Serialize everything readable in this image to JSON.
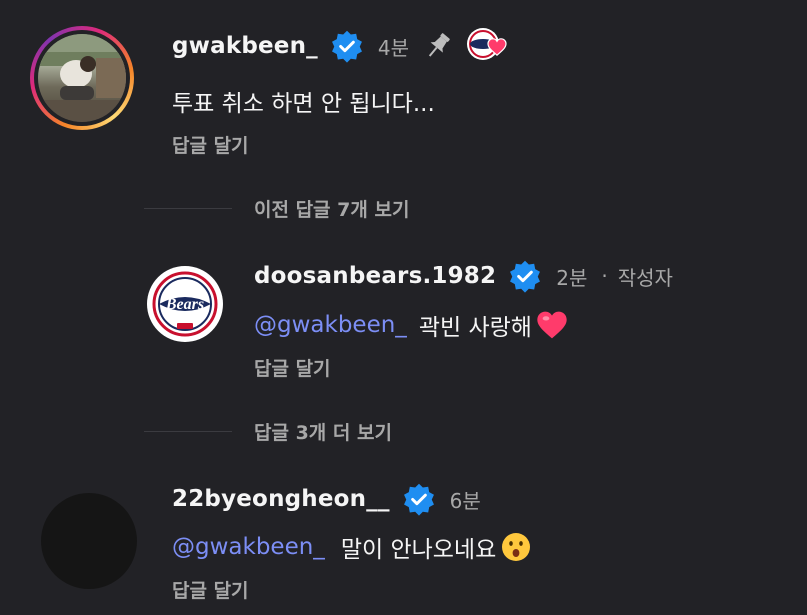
{
  "comments": [
    {
      "username": "gwakbeen_",
      "time": "4분",
      "text": "투표 취소 하면 안 됩니다...",
      "reply_label": "답글 달기",
      "pinned": true,
      "liked_by_author": true
    }
  ],
  "thread_prev": "이전 답글 7개 보기",
  "reply": {
    "username": "doosanbears.1982",
    "time": "2분",
    "separator": "·",
    "author_tag": "작성자",
    "mention": "@gwakbeen_",
    "text": "곽빈 사랑해",
    "emoji": "heart",
    "reply_label": "답글 달기"
  },
  "thread_more": "답글 3개 더 보기",
  "comment2": {
    "username": "22byeongheon__",
    "time": "6분",
    "mention": "@gwakbeen_",
    "text": "말이 안나오네요",
    "emoji": "astonished-face",
    "reply_label": "답글 달기"
  },
  "logo_text": "Bears",
  "colors": {
    "background": "#222226",
    "verified": "#1f8ef1",
    "mention": "#7c8ef5",
    "heart": "#ff3b6b",
    "muted": "#a8a8a8"
  }
}
